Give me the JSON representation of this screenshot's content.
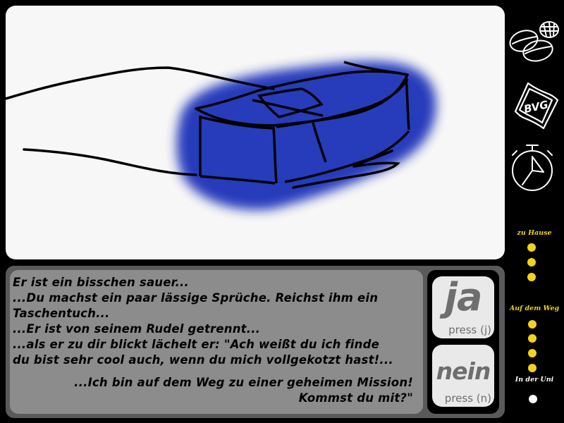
{
  "dialog": {
    "lines": [
      "Er ist ein bisschen sauer...",
      "...Du machst ein paar lässige Sprüche. Reichst ihm ein",
      "Taschentuch...",
      "...Er ist von seinem Rudel getrennt...",
      "...als er zu dir blickt lächelt er: \"Ach weißt du ich finde",
      "du bist sehr cool auch, wenn du mich vollgekotzt hast!..."
    ],
    "quote_lines": [
      "...Ich bin auf dem Weg zu einer geheimen Mission!",
      "Kommst du mit?\""
    ]
  },
  "choices": {
    "yes": {
      "word": "ja",
      "hint": "press (j)"
    },
    "no": {
      "word": "nein",
      "hint": "press (n)"
    }
  },
  "sidebar": {
    "items_icon": "coffee-beans-icon",
    "ticket_icon": "bvg-ticket-icon",
    "ticket_label": "BVG",
    "timer_icon": "stopwatch-icon"
  },
  "progress": {
    "stages": [
      {
        "label": "zu Hause",
        "dots": 3,
        "active": 0
      },
      {
        "label": "Auf dem Weg",
        "dots": 4,
        "active": 0
      },
      {
        "label": "In der Uni",
        "dots": 1,
        "active": 0
      }
    ],
    "colors": {
      "label_active": "#f2d21c",
      "label_inactive": "#ffffff",
      "dot_yellow": "#f2d21c",
      "dot_white": "#ffffff"
    }
  },
  "scene": {
    "highlight_color": "#1f33b8"
  }
}
